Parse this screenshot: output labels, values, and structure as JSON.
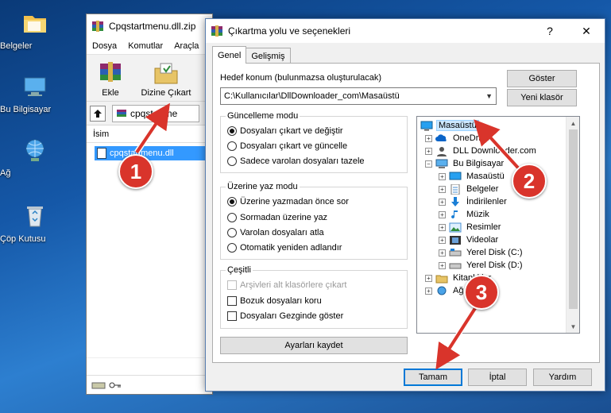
{
  "desktop": {
    "icons": [
      {
        "label": "Belgeler",
        "icon": "folder-icon"
      },
      {
        "label": "Bu Bilgisayar",
        "icon": "computer-icon"
      },
      {
        "label": "Ağ",
        "icon": "network-icon"
      },
      {
        "label": "Çöp Kutusu",
        "icon": "recycle-bin-icon"
      }
    ]
  },
  "winrar": {
    "title": "Cpqstartmenu.dll.zip",
    "menu": [
      "Dosya",
      "Komutlar",
      "Araçla"
    ],
    "toolbar": {
      "add_label": "Ekle",
      "extract_label": "Dizine Çıkart"
    },
    "address": "cpqstartme",
    "column_name": "İsim",
    "file_name": "cpqstartmenu.dll"
  },
  "dialog": {
    "title": "Çıkartma yolu ve seçenekleri",
    "close_symbol": "✕",
    "help_symbol": "?",
    "tabs": [
      "Genel",
      "Gelişmiş"
    ],
    "dest_label": "Hedef konum (bulunmazsa oluşturulacak)",
    "dest_value": "C:\\Kullanıcılar\\DllDownloader_com\\Masaüstü",
    "show_button": "Göster",
    "new_folder_button": "Yeni klasör",
    "update_mode": {
      "title": "Güncelleme modu",
      "options": [
        "Dosyaları çıkart ve değiştir",
        "Dosyaları çıkart ve güncelle",
        "Sadece varolan dosyaları tazele"
      ],
      "selected": 0
    },
    "overwrite_mode": {
      "title": "Üzerine yaz modu",
      "options": [
        "Üzerine yazmadan önce sor",
        "Sormadan üzerine yaz",
        "Varolan dosyaları atla",
        "Otomatik yeniden adlandır"
      ],
      "selected": 0
    },
    "misc": {
      "title": "Çeşitli",
      "options": [
        "Arşivleri alt klasörlere çıkart",
        "Bozuk dosyaları koru",
        "Dosyaları Gezginde göster"
      ]
    },
    "save_settings_button": "Ayarları kaydet",
    "tree": [
      {
        "label": "Masaüstü",
        "icon": "desktop-icon",
        "selected": true
      },
      {
        "label": "OneDrive",
        "icon": "onedrive-icon"
      },
      {
        "label": "DLL Downloader.com",
        "icon": "user-icon"
      },
      {
        "label": "Bu Bilgisayar",
        "icon": "computer-icon"
      },
      {
        "label": "Masaüstü",
        "icon": "desktop-icon"
      },
      {
        "label": "Belgeler",
        "icon": "documents-icon"
      },
      {
        "label": "İndirilenler",
        "icon": "downloads-icon"
      },
      {
        "label": "Müzik",
        "icon": "music-icon"
      },
      {
        "label": "Resimler",
        "icon": "pictures-icon"
      },
      {
        "label": "Videolar",
        "icon": "videos-icon"
      },
      {
        "label": "Yerel Disk (C:)",
        "icon": "drive-icon"
      },
      {
        "label": "Yerel Disk (D:)",
        "icon": "drive-icon"
      },
      {
        "label": "Kitaplıklar",
        "icon": "libraries-icon"
      },
      {
        "label": "Ağ",
        "icon": "network-icon"
      }
    ],
    "ok_button": "Tamam",
    "cancel_button": "İptal",
    "help_button": "Yardım"
  },
  "annotations": [
    "1",
    "2",
    "3"
  ],
  "colors": {
    "badge": "#d9342b",
    "selection": "#3399ff",
    "default_button_border": "#0078d7"
  }
}
